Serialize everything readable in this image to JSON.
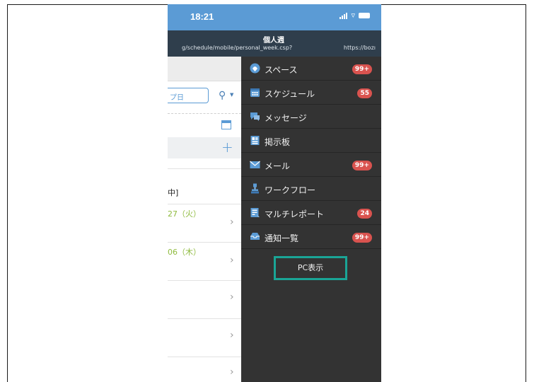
{
  "status_bar": {
    "time": "18:21"
  },
  "browser": {
    "page_title": "個人週",
    "url_left": "g/schedule/mobile/personal_week.csp?",
    "url_right": "https://bozı"
  },
  "background_page": {
    "date_field_partial": "プ日",
    "item_1_partial": "中]",
    "date_1_partial": "27（火）",
    "date_2_partial": "06（木）"
  },
  "menu": {
    "items": [
      {
        "label": "スペース",
        "icon": "space-icon",
        "badge": "99+"
      },
      {
        "label": "スケジュール",
        "icon": "calendar-icon",
        "badge": "55"
      },
      {
        "label": "メッセージ",
        "icon": "message-icon",
        "badge": ""
      },
      {
        "label": "掲示板",
        "icon": "bulletin-icon",
        "badge": ""
      },
      {
        "label": "メール",
        "icon": "mail-icon",
        "badge": "99+"
      },
      {
        "label": "ワークフロー",
        "icon": "workflow-icon",
        "badge": ""
      },
      {
        "label": "マルチレポート",
        "icon": "report-icon",
        "badge": "24"
      },
      {
        "label": "通知一覧",
        "icon": "notification-icon",
        "badge": "99+"
      }
    ],
    "pc_view_label": "PC表示"
  },
  "colors": {
    "accent": "#5b9bd5",
    "badge": "#d9534f",
    "highlight": "#1aa596",
    "menu_bg": "#333333"
  }
}
